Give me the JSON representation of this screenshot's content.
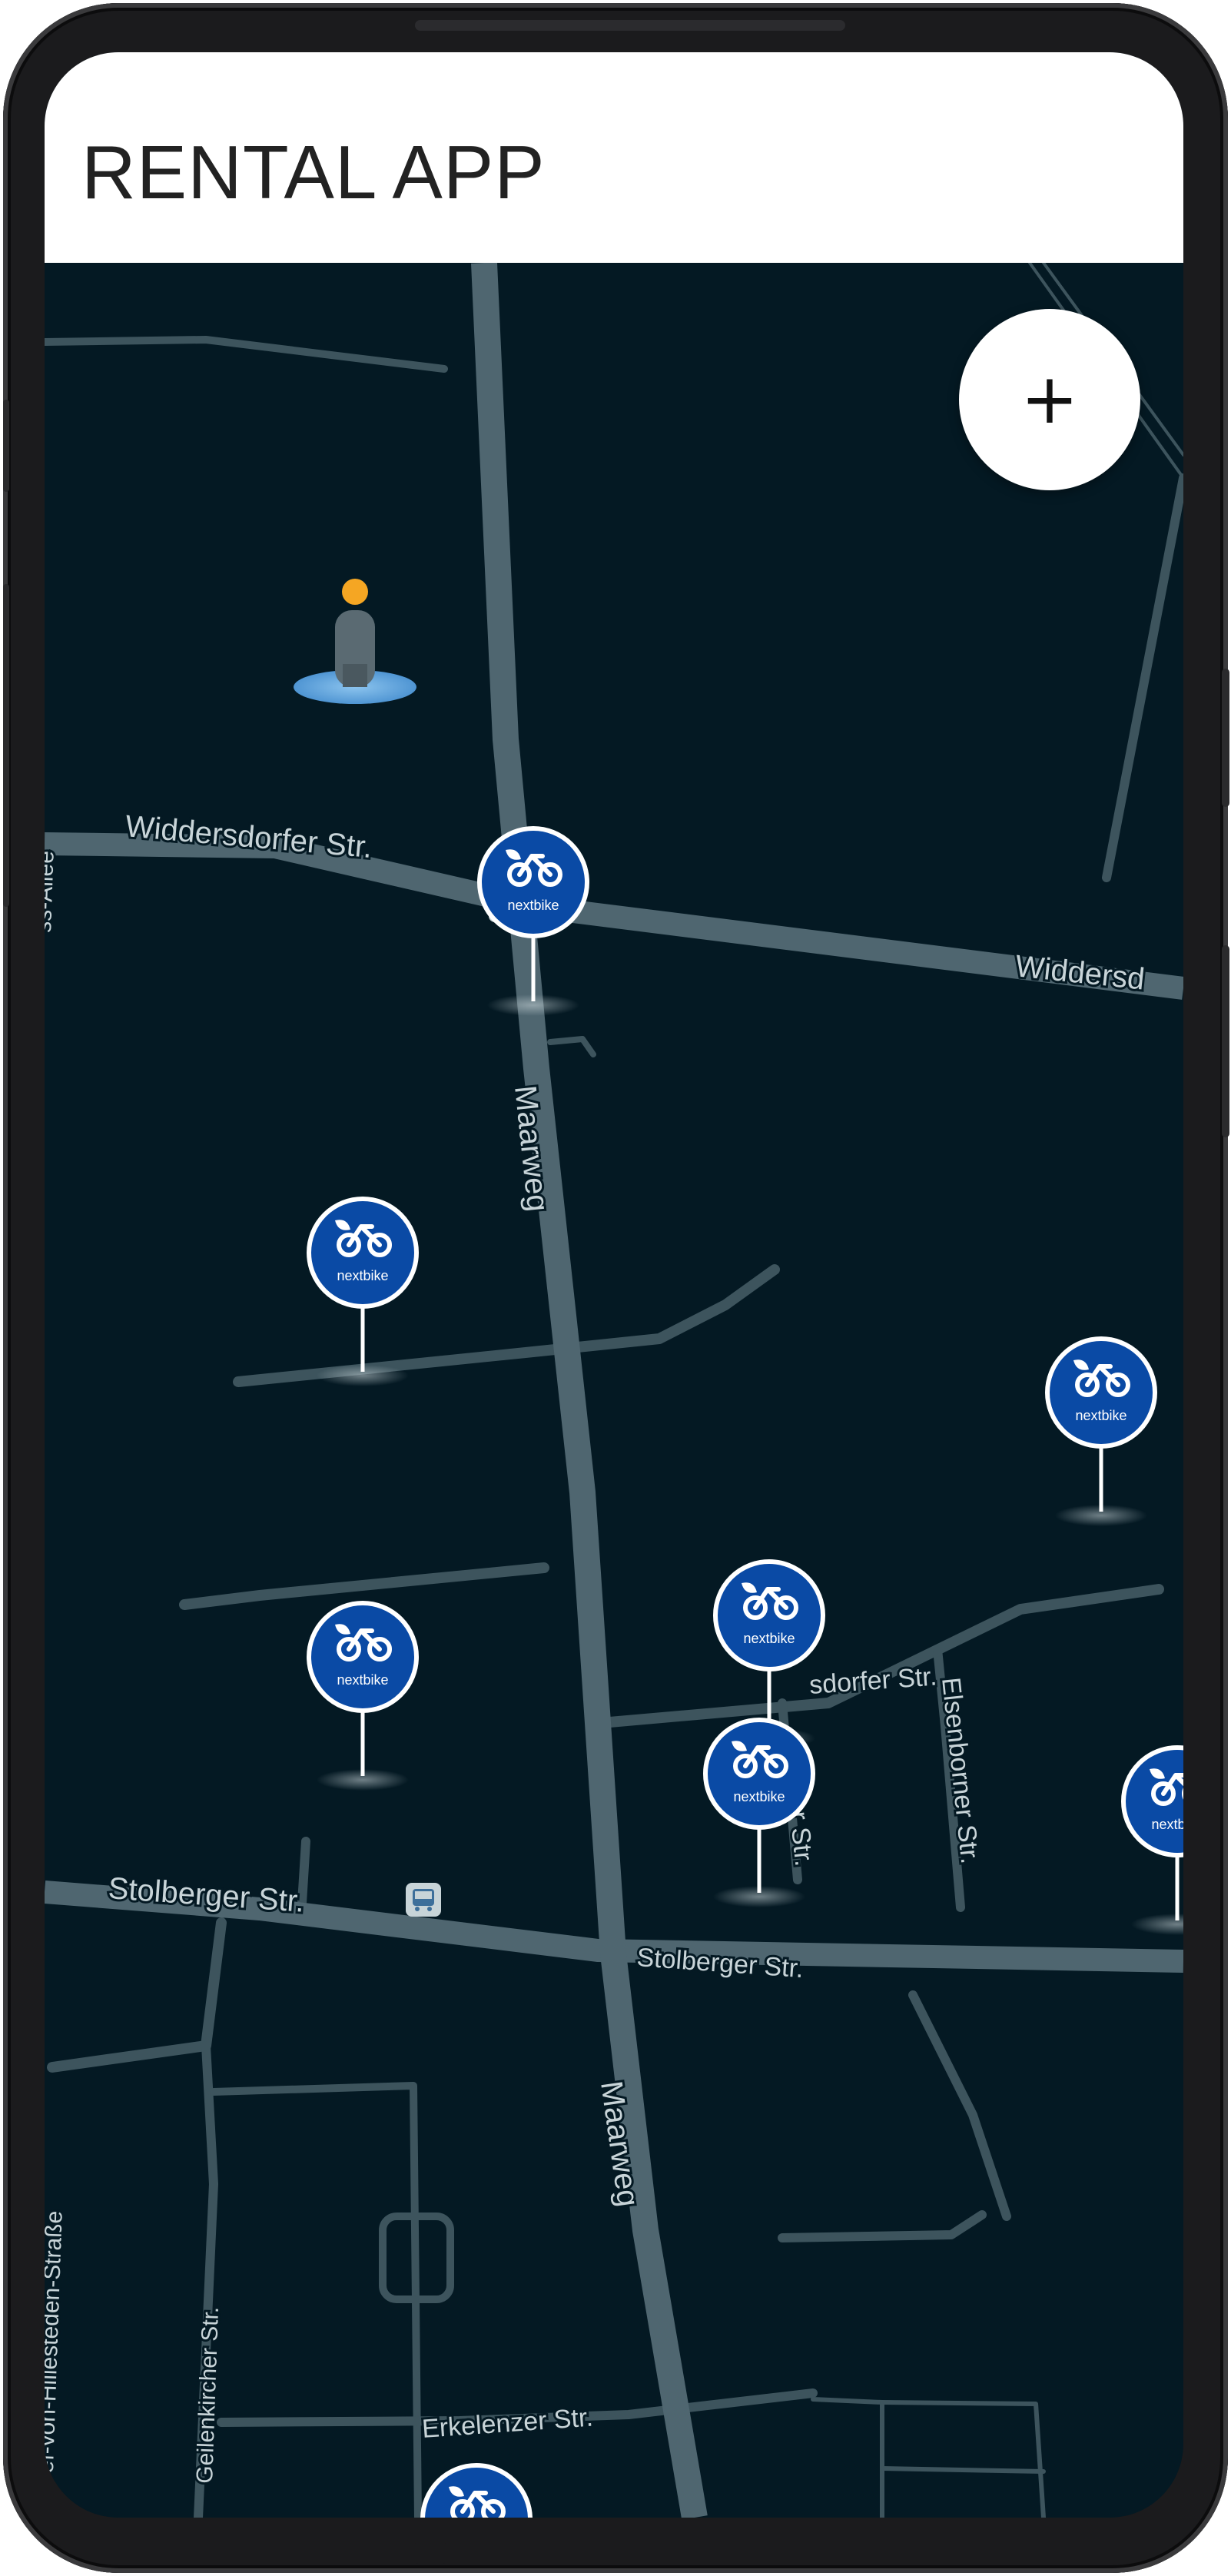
{
  "app": {
    "title": "RENTAL APP"
  },
  "controls": {
    "zoom_in_label": "+"
  },
  "streets": {
    "widdersdorfer": "Widdersdorfer Str.",
    "widdersdorfer_right": "Widdersd",
    "maarweg": "Maarweg",
    "maarweg_lower": "Maarweg",
    "stolberger_left": "Stolberger Str.",
    "stolberger_right": "Stolberger Str.",
    "elsenborner": "Elsenborner Str.",
    "middle_partial": "sdorfer Str.",
    "vertical_partial": "rther Str.",
    "geilenkirchener": "Geilenkircher Str.",
    "erkelenzer": "Erkelenzer Str.",
    "left_edge_top": "ss-Allee",
    "left_edge_bottom": "Gef-von-Hillesteden-Straße"
  },
  "station": {
    "brand": "nextbike",
    "icon": "bike-icon"
  },
  "colors": {
    "map_background": "#041923",
    "road": "#4f6670",
    "station_blue": "#0a4aa5",
    "user_location": "#5ba3df",
    "user_head": "#f5a623"
  }
}
